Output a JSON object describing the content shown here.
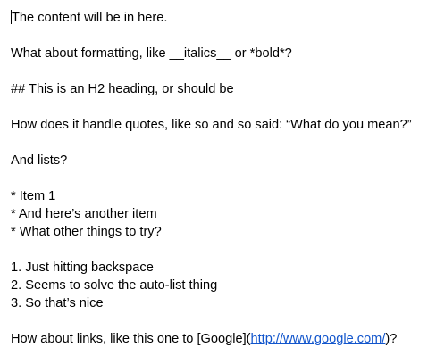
{
  "document": {
    "line1": "The content will be in here.",
    "line2": "What about formatting, like __italics__ or *bold*?",
    "line3": "## This is an H2 heading, or should be",
    "line4": "How does it handle quotes, like so and so said: “What do you mean?”",
    "line5": "And lists?",
    "bullets": [
      "* Item 1",
      "* And here’s another item",
      "* What other things to try?"
    ],
    "numbered": [
      "1. Just hitting backspace",
      "2. Seems to solve the auto-list thing",
      "3. So that’s nice"
    ],
    "links_prefix": "How about links, like this one to [Google](",
    "links_url": "http://www.google.com/",
    "links_suffix": ")?"
  },
  "colors": {
    "text": "#000000",
    "link": "#1155cc",
    "background": "#ffffff"
  }
}
